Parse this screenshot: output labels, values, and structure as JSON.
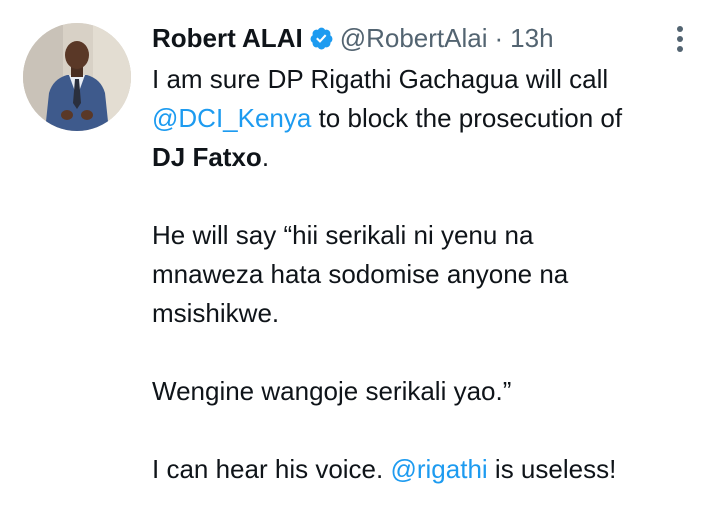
{
  "tweet": {
    "author": {
      "display_name": "Robert ALAI",
      "handle": "@RobertAlai",
      "verified_icon": "verified-badge-icon",
      "avatar": "profile-photo"
    },
    "separator": "·",
    "timestamp": "13h",
    "more_icon": "more-options-icon",
    "text": {
      "p1_a": "I am sure DP Rigathi Gachagua will call",
      "p1_mention": "@DCI_Kenya",
      "p1_b": " to block the prosecution of",
      "p1_bold": "DJ Fatxo",
      "p1_end": ".",
      "p2_line1": "He will say “hii serikali ni yenu na",
      "p2_line2": "mnaweza hata sodomise anyone na",
      "p2_line3": "msishikwe.",
      "p3": "Wengine wangoje serikali yao.”",
      "p4_a": "I can hear his voice. ",
      "p4_mention": "@rigathi",
      "p4_b": " is useless!"
    },
    "colors": {
      "text": "#0f1419",
      "secondary": "#536471",
      "link": "#1d9bf0",
      "verified": "#1d9bf0"
    }
  }
}
